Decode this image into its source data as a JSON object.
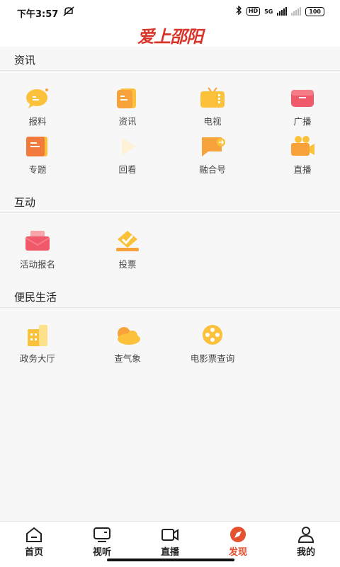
{
  "status_bar": {
    "time": "下午3:57",
    "hd": "HD",
    "network": "5G",
    "battery": "100"
  },
  "header": {
    "logo_text": "爱上邵阳"
  },
  "sections": {
    "news": {
      "title": "资讯",
      "items": [
        {
          "label": "报料",
          "icon": "chat-bubble-icon"
        },
        {
          "label": "资讯",
          "icon": "document-icon"
        },
        {
          "label": "电视",
          "icon": "tv-icon"
        },
        {
          "label": "广播",
          "icon": "radio-icon"
        },
        {
          "label": "专题",
          "icon": "topic-book-icon"
        },
        {
          "label": "回看",
          "icon": "playback-icon"
        },
        {
          "label": "融合号",
          "icon": "flag-icon"
        },
        {
          "label": "直播",
          "icon": "video-camera-icon"
        }
      ]
    },
    "interact": {
      "title": "互动",
      "items": [
        {
          "label": "活动报名",
          "icon": "envelope-icon"
        },
        {
          "label": "投票",
          "icon": "vote-check-icon"
        }
      ]
    },
    "life": {
      "title": "便民生活",
      "items": [
        {
          "label": "政务大厅",
          "icon": "building-icon"
        },
        {
          "label": "查气象",
          "icon": "weather-cloud-icon"
        },
        {
          "label": "电影票查询",
          "icon": "film-reel-icon"
        }
      ]
    }
  },
  "bottom_nav": {
    "items": [
      {
        "label": "首页",
        "icon": "home-icon"
      },
      {
        "label": "视听",
        "icon": "media-icon"
      },
      {
        "label": "直播",
        "icon": "live-camera-icon"
      },
      {
        "label": "发现",
        "icon": "compass-icon"
      },
      {
        "label": "我的",
        "icon": "user-icon"
      }
    ],
    "active": "发现"
  },
  "colors": {
    "accent": "#e5502e",
    "logo": "#d9352a",
    "icon_orange": "#f7a23b",
    "icon_yellow": "#fbc13a",
    "icon_red": "#f0596a"
  }
}
